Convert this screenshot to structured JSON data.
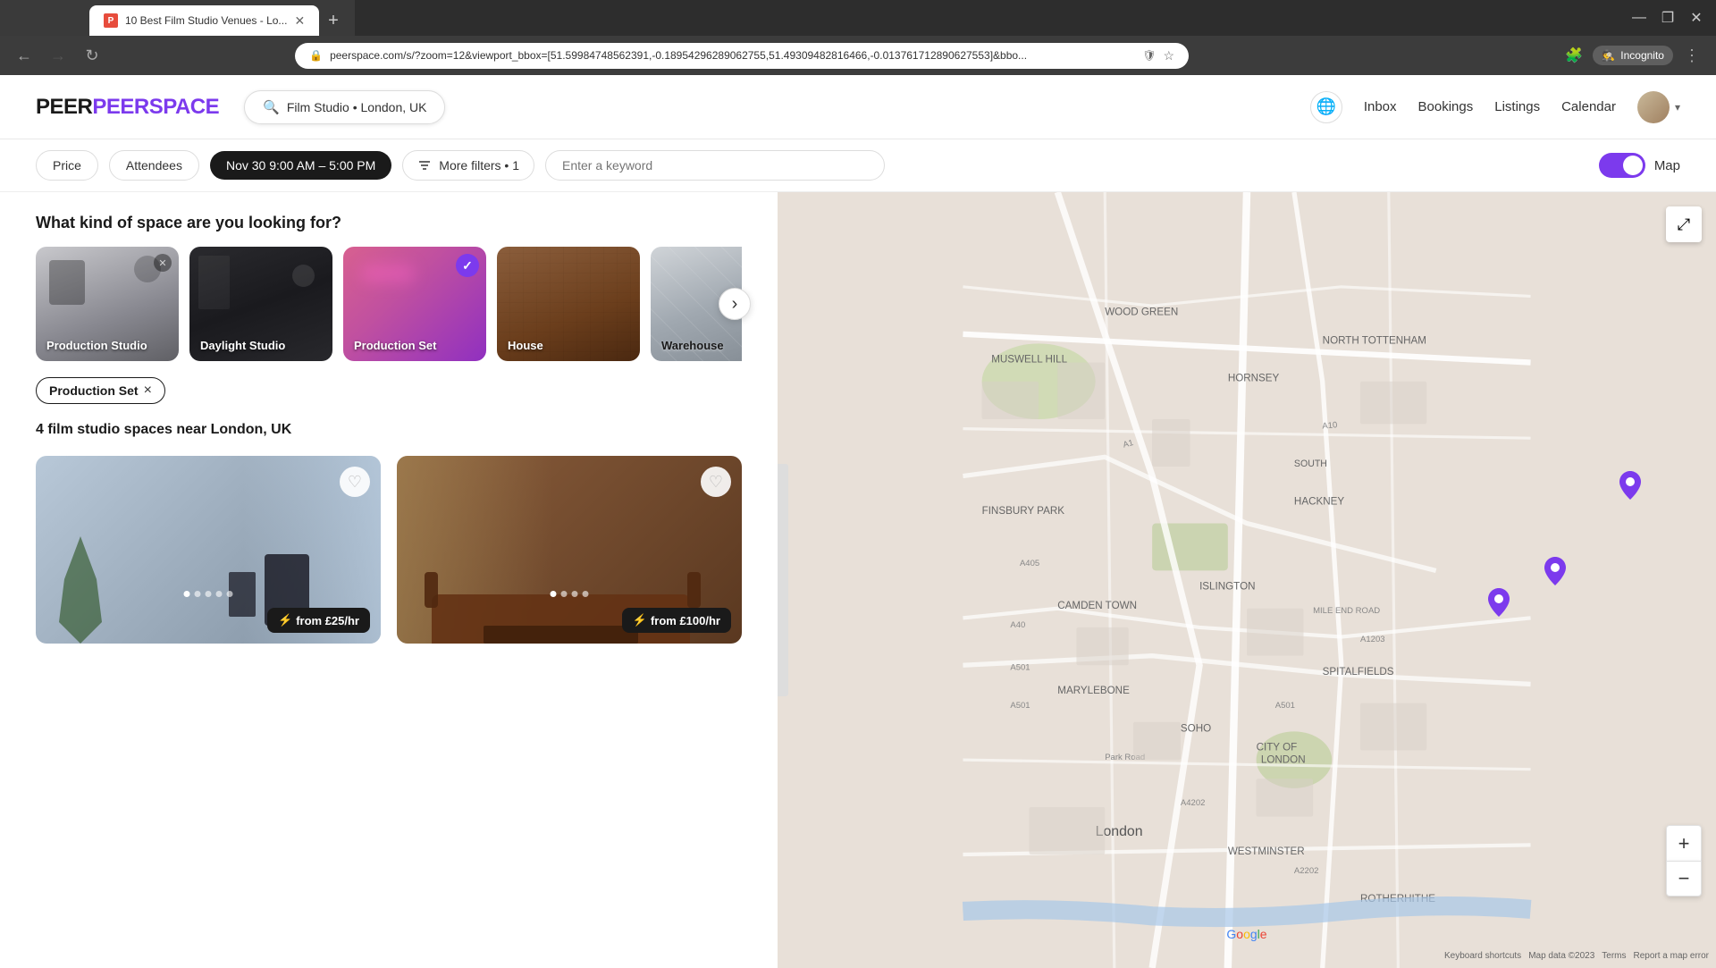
{
  "browser": {
    "tab_title": "10 Best Film Studio Venues - Lo...",
    "tab_favicon": "P",
    "address": "peerspace.com/s/?zoom=12&viewport_bbox=[51.59984748562391,-0.18954296289062755,51.49309482816466,-0.013761712890627553]&bbo...",
    "new_tab_label": "+",
    "incognito_label": "Incognito"
  },
  "site": {
    "logo": "PEERSPACE",
    "search_query": "Film Studio • London, UK",
    "nav": {
      "globe_icon": "🌐",
      "inbox": "Inbox",
      "bookings": "Bookings",
      "listings": "Listings",
      "calendar": "Calendar"
    }
  },
  "filters": {
    "price_label": "Price",
    "attendees_label": "Attendees",
    "date_label": "Nov 30 9:00 AM – 5:00 PM",
    "more_filters_label": "More filters • 1",
    "keyword_placeholder": "Enter a keyword",
    "map_label": "Map",
    "filter_count": "1"
  },
  "space_section": {
    "title": "What kind of space are you looking for?",
    "types": [
      {
        "label": "Production Studio",
        "has_x": true,
        "is_selected": false
      },
      {
        "label": "Daylight Studio",
        "has_x": false,
        "is_selected": false
      },
      {
        "label": "Production Set",
        "has_x": false,
        "is_selected": true
      },
      {
        "label": "House",
        "has_x": false,
        "is_selected": false
      },
      {
        "label": "Warehouse",
        "has_x": false,
        "is_selected": false
      }
    ],
    "carousel_next": "›"
  },
  "active_filters": {
    "tags": [
      {
        "label": "Production Set",
        "x": "×"
      }
    ]
  },
  "results": {
    "count_text": "4 film studio spaces near London, UK",
    "listings": [
      {
        "id": 1,
        "price_from": "from £25/hr",
        "dots": 5,
        "active_dot": 0
      },
      {
        "id": 2,
        "price_from": "from £100/hr",
        "dots": 4,
        "active_dot": 0
      }
    ]
  },
  "map": {
    "expand_icon": "⤢",
    "zoom_in": "+",
    "zoom_out": "−",
    "google_text": "Google",
    "terms_text": "Terms",
    "report_text": "Report a map error",
    "keyboard_text": "Keyboard shortcuts",
    "map_data": "Map data ©2023"
  },
  "icons": {
    "heart": "♡",
    "heart_filled": "♥",
    "lightning": "⚡",
    "search": "🔍",
    "close": "×",
    "chevron_right": "›",
    "chevron_left": "‹",
    "check": "✓",
    "globe": "🌐",
    "back": "←",
    "forward": "→",
    "refresh": "↻",
    "lock": "🔒",
    "star": "⭐",
    "shield": "🕵",
    "menu_dots": "⋮",
    "grid": "⊞",
    "minimize": "—",
    "maximize": "❐",
    "window_close": "✕"
  }
}
